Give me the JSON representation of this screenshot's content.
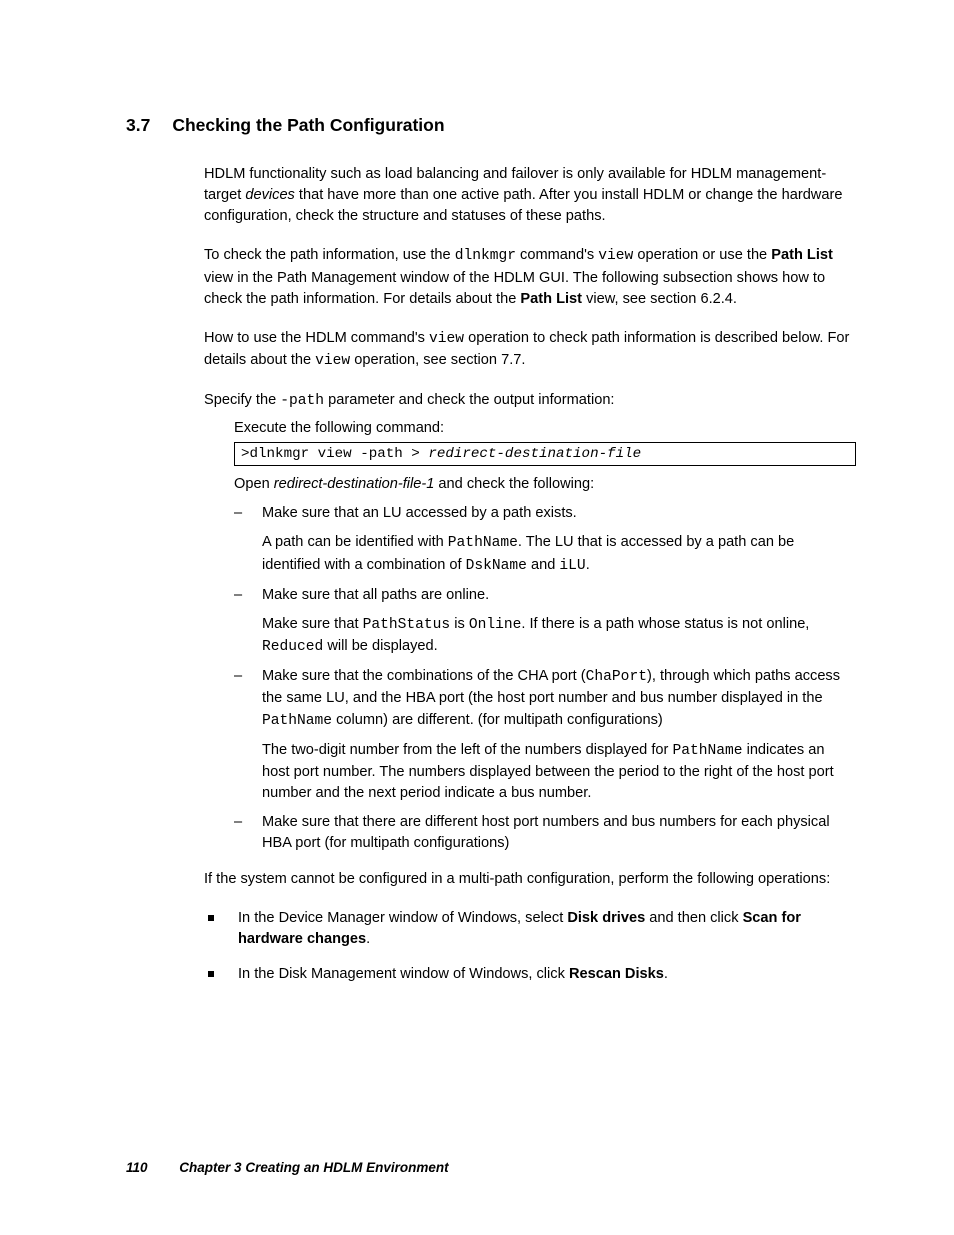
{
  "heading": {
    "number": "3.7",
    "title": "Checking the Path Configuration"
  },
  "p1": {
    "a": "HDLM functionality such as load balancing and failover is only available for HDLM management-target ",
    "em": "devices",
    "b": " that have more than one active path. After you install HDLM or change the hardware configuration, check the structure and statuses of these paths."
  },
  "p2": {
    "a": "To check the path information, use the ",
    "m1": "dlnkmgr",
    "b": " command's ",
    "m2": "view",
    "c": " operation or use the ",
    "s1": "Path List",
    "d": " view in the Path Management window of the HDLM GUI. The following subsection shows how to check the path information. For details about the ",
    "s2": "Path List",
    "e": " view, see section 6.2.4."
  },
  "p3": {
    "a": "How to use the HDLM command's ",
    "m1": "view",
    "b": " operation to check path information is described below. For details about the ",
    "m2": "view",
    "c": " operation, see section 7.7."
  },
  "p4": {
    "a": "Specify the ",
    "m1": "-path",
    "b": " parameter and check the output information:"
  },
  "exec_label": "Execute the following command:",
  "code": {
    "a": ">dlnkmgr view -path > ",
    "i": "redirect-destination-file"
  },
  "p5": {
    "a": "Open ",
    "em": "redirect-destination-file-1",
    "b": " and check the following:"
  },
  "dash": [
    {
      "line1": "Make sure that an LU accessed by a path exists.",
      "sub": {
        "a": "A path can be identified with ",
        "m1": "PathName",
        "b": ". The LU that is accessed by a path can be identified with a combination of ",
        "m2": "DskName",
        "c": " and ",
        "m3": "iLU",
        "d": "."
      }
    },
    {
      "line1": "Make sure that all paths are online.",
      "sub": {
        "a": "Make sure that ",
        "m1": "PathStatus",
        "b": " is ",
        "m2": "Online",
        "c": ". If there is a path whose status is not online, ",
        "m3": "Reduced",
        "d": " will be displayed."
      }
    },
    {
      "line1": {
        "a": "Make sure that the combinations of the CHA port (",
        "m1": "ChaPort",
        "b": "), through which paths access the same LU, and the HBA port (the host port number and bus number displayed in the ",
        "m2": "PathName",
        "c": "  column) are different. (for multipath configurations)"
      },
      "sub": {
        "a": "The two-digit number from the left of the numbers displayed for ",
        "m1": "PathName",
        "b": " indicates an host port number. The numbers displayed between the period to the right of the host port number and the next period indicate a bus number."
      }
    },
    {
      "line1": "Make sure that there are different host port numbers and bus numbers for each physical HBA port (for multipath configurations)"
    }
  ],
  "p6": "If the system cannot be configured in a multi-path configuration, perform the following operations:",
  "square": [
    {
      "a": "In the Device Manager window of Windows, select ",
      "s1": "Disk drives",
      "b": " and then click ",
      "s2": "Scan for hardware changes",
      "c": "."
    },
    {
      "a": "In the Disk Management window of Windows, click ",
      "s1": "Rescan Disks",
      "b": "."
    }
  ],
  "footer": {
    "page": "110",
    "chapter": "Chapter 3   Creating an HDLM Environment"
  }
}
